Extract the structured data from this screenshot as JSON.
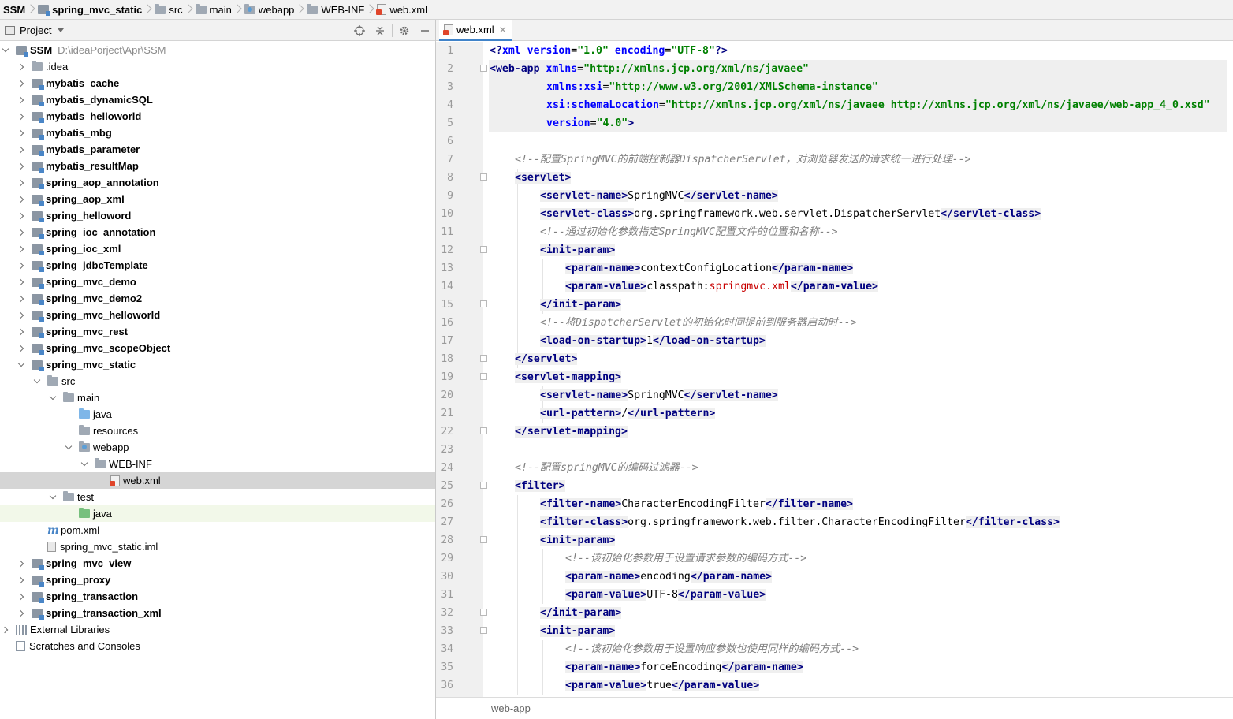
{
  "breadcrumb": [
    {
      "label": "SSM",
      "icon": "none",
      "bold": true
    },
    {
      "label": "spring_mvc_static",
      "icon": "module-icon",
      "bold": true
    },
    {
      "label": "src",
      "icon": "folder-icon",
      "bold": false
    },
    {
      "label": "main",
      "icon": "folder-icon",
      "bold": false
    },
    {
      "label": "webapp",
      "icon": "web-folder-icon",
      "bold": false
    },
    {
      "label": "WEB-INF",
      "icon": "folder-icon",
      "bold": false
    },
    {
      "label": "web.xml",
      "icon": "xml-file-icon",
      "bold": false
    }
  ],
  "project_panel": {
    "title": "Project",
    "tools": [
      "locate-icon",
      "collapse-icon",
      "gear-icon",
      "minimize-icon"
    ]
  },
  "tree": [
    {
      "depth": 0,
      "arrow": "down",
      "icon": "module",
      "label": "SSM",
      "bold": true,
      "path": "D:\\ideaPorject\\Apr\\SSM"
    },
    {
      "depth": 1,
      "arrow": "right",
      "icon": "folder",
      "label": ".idea",
      "bold": false
    },
    {
      "depth": 1,
      "arrow": "right",
      "icon": "module",
      "label": "mybatis_cache",
      "bold": true
    },
    {
      "depth": 1,
      "arrow": "right",
      "icon": "module",
      "label": "mybatis_dynamicSQL",
      "bold": true
    },
    {
      "depth": 1,
      "arrow": "right",
      "icon": "module",
      "label": "mybatis_helloworld",
      "bold": true
    },
    {
      "depth": 1,
      "arrow": "right",
      "icon": "module",
      "label": "mybatis_mbg",
      "bold": true
    },
    {
      "depth": 1,
      "arrow": "right",
      "icon": "module",
      "label": "mybatis_parameter",
      "bold": true
    },
    {
      "depth": 1,
      "arrow": "right",
      "icon": "module",
      "label": "mybatis_resultMap",
      "bold": true
    },
    {
      "depth": 1,
      "arrow": "right",
      "icon": "module",
      "label": "spring_aop_annotation",
      "bold": true
    },
    {
      "depth": 1,
      "arrow": "right",
      "icon": "module",
      "label": "spring_aop_xml",
      "bold": true
    },
    {
      "depth": 1,
      "arrow": "right",
      "icon": "module",
      "label": "spring_helloword",
      "bold": true
    },
    {
      "depth": 1,
      "arrow": "right",
      "icon": "module",
      "label": "spring_ioc_annotation",
      "bold": true
    },
    {
      "depth": 1,
      "arrow": "right",
      "icon": "module",
      "label": "spring_ioc_xml",
      "bold": true
    },
    {
      "depth": 1,
      "arrow": "right",
      "icon": "module",
      "label": "spring_jdbcTemplate",
      "bold": true
    },
    {
      "depth": 1,
      "arrow": "right",
      "icon": "module",
      "label": "spring_mvc_demo",
      "bold": true
    },
    {
      "depth": 1,
      "arrow": "right",
      "icon": "module",
      "label": "spring_mvc_demo2",
      "bold": true
    },
    {
      "depth": 1,
      "arrow": "right",
      "icon": "module",
      "label": "spring_mvc_helloworld",
      "bold": true
    },
    {
      "depth": 1,
      "arrow": "right",
      "icon": "module",
      "label": "spring_mvc_rest",
      "bold": true
    },
    {
      "depth": 1,
      "arrow": "right",
      "icon": "module",
      "label": "spring_mvc_scopeObject",
      "bold": true
    },
    {
      "depth": 1,
      "arrow": "down",
      "icon": "module",
      "label": "spring_mvc_static",
      "bold": true
    },
    {
      "depth": 2,
      "arrow": "down",
      "icon": "folder",
      "label": "src",
      "bold": false
    },
    {
      "depth": 3,
      "arrow": "down",
      "icon": "folder",
      "label": "main",
      "bold": false
    },
    {
      "depth": 4,
      "arrow": "none",
      "icon": "folder-blue",
      "label": "java",
      "bold": false
    },
    {
      "depth": 4,
      "arrow": "none",
      "icon": "folder-res",
      "label": "resources",
      "bold": false
    },
    {
      "depth": 4,
      "arrow": "down",
      "icon": "folder-web",
      "label": "webapp",
      "bold": false
    },
    {
      "depth": 5,
      "arrow": "down",
      "icon": "folder",
      "label": "WEB-INF",
      "bold": false
    },
    {
      "depth": 6,
      "arrow": "none",
      "icon": "xml",
      "label": "web.xml",
      "bold": false,
      "selected": true
    },
    {
      "depth": 3,
      "arrow": "down",
      "icon": "folder",
      "label": "test",
      "bold": false
    },
    {
      "depth": 4,
      "arrow": "none",
      "icon": "folder-green",
      "label": "java",
      "bold": false,
      "highlight": true
    },
    {
      "depth": 2,
      "arrow": "none",
      "icon": "maven",
      "label": "pom.xml",
      "bold": false
    },
    {
      "depth": 2,
      "arrow": "none",
      "icon": "iml",
      "label": "spring_mvc_static.iml",
      "bold": false
    },
    {
      "depth": 1,
      "arrow": "right",
      "icon": "module",
      "label": "spring_mvc_view",
      "bold": true
    },
    {
      "depth": 1,
      "arrow": "right",
      "icon": "module",
      "label": "spring_proxy",
      "bold": true
    },
    {
      "depth": 1,
      "arrow": "right",
      "icon": "module",
      "label": "spring_transaction",
      "bold": true
    },
    {
      "depth": 1,
      "arrow": "right",
      "icon": "module",
      "label": "spring_transaction_xml",
      "bold": true
    },
    {
      "depth": 0,
      "arrow": "right",
      "icon": "library",
      "label": "External Libraries",
      "bold": false
    },
    {
      "depth": 0,
      "arrow": "none",
      "icon": "scratch",
      "label": "Scratches and Consoles",
      "bold": false
    }
  ],
  "editor": {
    "tab_label": "web.xml",
    "status_path": "web-app",
    "lines": [
      {
        "n": "1",
        "indent": 0,
        "parts": [
          [
            "t",
            "<?"
          ],
          [
            "attr",
            "xml "
          ],
          [
            "attr",
            "version"
          ],
          [
            "p",
            "="
          ],
          [
            "val",
            "\"1.0\" "
          ],
          [
            "attr",
            "encoding"
          ],
          [
            "p",
            "="
          ],
          [
            "val",
            "\"UTF-8\""
          ],
          [
            "t",
            "?>"
          ]
        ],
        "shade": false
      },
      {
        "n": "2",
        "indent": 0,
        "fold": true,
        "parts": [
          [
            "tag",
            "<web-app "
          ],
          [
            "attr",
            "xmlns"
          ],
          [
            "p",
            "="
          ],
          [
            "val",
            "\"http://xmlns.jcp.org/xml/ns/javaee\""
          ]
        ],
        "shade": true
      },
      {
        "n": "3",
        "indent": 9,
        "parts": [
          [
            "attr",
            "xmlns:xsi"
          ],
          [
            "p",
            "="
          ],
          [
            "val",
            "\"http://www.w3.org/2001/XMLSchema-instance\""
          ]
        ],
        "shade": true
      },
      {
        "n": "4",
        "indent": 9,
        "parts": [
          [
            "attr",
            "xsi:schemaLocation"
          ],
          [
            "p",
            "="
          ],
          [
            "val",
            "\"http://xmlns.jcp.org/xml/ns/javaee http://xmlns.jcp.org/xml/ns/javaee/web-app_4_0.xsd\""
          ]
        ],
        "shade": true
      },
      {
        "n": "5",
        "indent": 9,
        "parts": [
          [
            "attr",
            "version"
          ],
          [
            "p",
            "="
          ],
          [
            "val",
            "\"4.0\""
          ],
          [
            "tag",
            ">"
          ]
        ],
        "shade": true
      },
      {
        "n": "6",
        "indent": 0,
        "parts": [],
        "shade": false
      },
      {
        "n": "7",
        "indent": 4,
        "parts": [
          [
            "cmt",
            "<!--配置SpringMVC的前端控制器DispatcherServlet，对浏览器发送的请求统一进行处理-->"
          ]
        ],
        "shade": false
      },
      {
        "n": "8",
        "indent": 4,
        "fold": true,
        "parts": [
          [
            "tag",
            "<servlet>"
          ]
        ],
        "shade": false
      },
      {
        "n": "9",
        "indent": 8,
        "parts": [
          [
            "tag",
            "<servlet-name>"
          ],
          [
            "p",
            "SpringMVC"
          ],
          [
            "tag",
            "</servlet-name>"
          ]
        ],
        "shade": false
      },
      {
        "n": "10",
        "indent": 8,
        "parts": [
          [
            "tag",
            "<servlet-class>"
          ],
          [
            "p",
            "org.springframework.web.servlet.DispatcherServlet"
          ],
          [
            "tag",
            "</servlet-class>"
          ]
        ],
        "shade": false
      },
      {
        "n": "11",
        "indent": 8,
        "parts": [
          [
            "cmt",
            "<!--通过初始化参数指定SpringMVC配置文件的位置和名称-->"
          ]
        ],
        "shade": false
      },
      {
        "n": "12",
        "indent": 8,
        "fold": true,
        "parts": [
          [
            "tag",
            "<init-param>"
          ]
        ],
        "shade": false
      },
      {
        "n": "13",
        "indent": 12,
        "parts": [
          [
            "tag",
            "<param-name>"
          ],
          [
            "p",
            "contextConfigLocation"
          ],
          [
            "tag",
            "</param-name>"
          ]
        ],
        "shade": false
      },
      {
        "n": "14",
        "indent": 12,
        "parts": [
          [
            "tag",
            "<param-value>"
          ],
          [
            "p",
            "classpath:"
          ],
          [
            "red",
            "springmvc.xml"
          ],
          [
            "tag",
            "</param-value>"
          ]
        ],
        "shade": false
      },
      {
        "n": "15",
        "indent": 8,
        "fold": true,
        "parts": [
          [
            "tag",
            "</init-param>"
          ]
        ],
        "shade": false
      },
      {
        "n": "16",
        "indent": 8,
        "parts": [
          [
            "cmt",
            "<!--将DispatcherServlet的初始化时间提前到服务器启动时-->"
          ]
        ],
        "shade": false
      },
      {
        "n": "17",
        "indent": 8,
        "parts": [
          [
            "tag",
            "<load-on-startup>"
          ],
          [
            "p",
            "1"
          ],
          [
            "tag",
            "</load-on-startup>"
          ]
        ],
        "shade": false
      },
      {
        "n": "18",
        "indent": 4,
        "fold": true,
        "parts": [
          [
            "tag",
            "</servlet>"
          ]
        ],
        "shade": false
      },
      {
        "n": "19",
        "indent": 4,
        "fold": true,
        "parts": [
          [
            "tag",
            "<servlet-mapping>"
          ]
        ],
        "shade": false
      },
      {
        "n": "20",
        "indent": 8,
        "parts": [
          [
            "tag",
            "<servlet-name>"
          ],
          [
            "p",
            "SpringMVC"
          ],
          [
            "tag",
            "</servlet-name>"
          ]
        ],
        "shade": false
      },
      {
        "n": "21",
        "indent": 8,
        "parts": [
          [
            "tag",
            "<url-pattern>"
          ],
          [
            "p",
            "/"
          ],
          [
            "tag",
            "</url-pattern>"
          ]
        ],
        "shade": false
      },
      {
        "n": "22",
        "indent": 4,
        "fold": true,
        "parts": [
          [
            "tag",
            "</servlet-mapping>"
          ]
        ],
        "shade": false
      },
      {
        "n": "23",
        "indent": 0,
        "parts": [],
        "shade": false
      },
      {
        "n": "24",
        "indent": 4,
        "parts": [
          [
            "cmt",
            "<!--配置springMVC的编码过滤器-->"
          ]
        ],
        "shade": false
      },
      {
        "n": "25",
        "indent": 4,
        "fold": true,
        "parts": [
          [
            "tag",
            "<filter>"
          ]
        ],
        "shade": false
      },
      {
        "n": "26",
        "indent": 8,
        "parts": [
          [
            "tag",
            "<filter-name>"
          ],
          [
            "p",
            "CharacterEncodingFilter"
          ],
          [
            "tag",
            "</filter-name>"
          ]
        ],
        "shade": false
      },
      {
        "n": "27",
        "indent": 8,
        "parts": [
          [
            "tag",
            "<filter-class>"
          ],
          [
            "p",
            "org.springframework.web.filter.CharacterEncodingFilter"
          ],
          [
            "tag",
            "</filter-class>"
          ]
        ],
        "shade": false
      },
      {
        "n": "28",
        "indent": 8,
        "fold": true,
        "parts": [
          [
            "tag",
            "<init-param>"
          ]
        ],
        "shade": false
      },
      {
        "n": "29",
        "indent": 12,
        "parts": [
          [
            "cmt",
            "<!--该初始化参数用于设置请求参数的编码方式-->"
          ]
        ],
        "shade": false
      },
      {
        "n": "30",
        "indent": 12,
        "parts": [
          [
            "tag",
            "<param-name>"
          ],
          [
            "p",
            "encoding"
          ],
          [
            "tag",
            "</param-name>"
          ]
        ],
        "shade": false
      },
      {
        "n": "31",
        "indent": 12,
        "parts": [
          [
            "tag",
            "<param-value>"
          ],
          [
            "p",
            "UTF-8"
          ],
          [
            "tag",
            "</param-value>"
          ]
        ],
        "shade": false
      },
      {
        "n": "32",
        "indent": 8,
        "fold": true,
        "parts": [
          [
            "tag",
            "</init-param>"
          ]
        ],
        "shade": false
      },
      {
        "n": "33",
        "indent": 8,
        "fold": true,
        "parts": [
          [
            "tag",
            "<init-param>"
          ]
        ],
        "shade": false
      },
      {
        "n": "34",
        "indent": 12,
        "parts": [
          [
            "cmt",
            "<!--该初始化参数用于设置响应参数也使用同样的编码方式-->"
          ]
        ],
        "shade": false
      },
      {
        "n": "35",
        "indent": 12,
        "parts": [
          [
            "tag",
            "<param-name>"
          ],
          [
            "p",
            "forceEncoding"
          ],
          [
            "tag",
            "</param-name>"
          ]
        ],
        "shade": false
      },
      {
        "n": "36",
        "indent": 12,
        "parts": [
          [
            "tag",
            "<param-value>"
          ],
          [
            "p",
            "true"
          ],
          [
            "tag",
            "</param-value>"
          ]
        ],
        "shade": false
      }
    ]
  },
  "colors": {
    "tag": "#000080",
    "attr": "#0000ff",
    "value": "#008000",
    "comment": "#808080",
    "selection": "#d5d5d5",
    "tab_accent": "#4083c9"
  }
}
